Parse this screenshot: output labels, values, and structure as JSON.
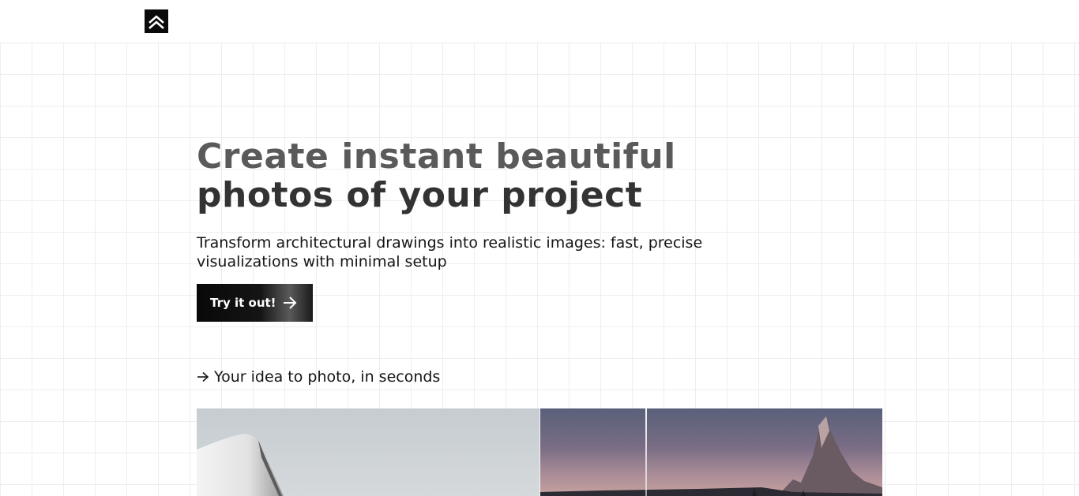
{
  "header": {
    "logo_icon": "double-chevron-up-icon"
  },
  "hero": {
    "title_line1": "Create instant beautiful",
    "title_line2": "photos of your project",
    "subtitle": "Transform architectural drawings into realistic images: fast, precise visualizations with minimal setup",
    "cta_label": "Try it out!",
    "cta_icon": "arrow-right-icon"
  },
  "section": {
    "tagline": "Your idea to photo, in seconds",
    "tagline_icon": "arrow-right-icon"
  },
  "colors": {
    "background": "#ffffff",
    "grid_line": "#eeeeee",
    "title_light": "#5a5a5a",
    "title_dark": "#333333",
    "button_bg": "#080808",
    "text": "#151515"
  }
}
